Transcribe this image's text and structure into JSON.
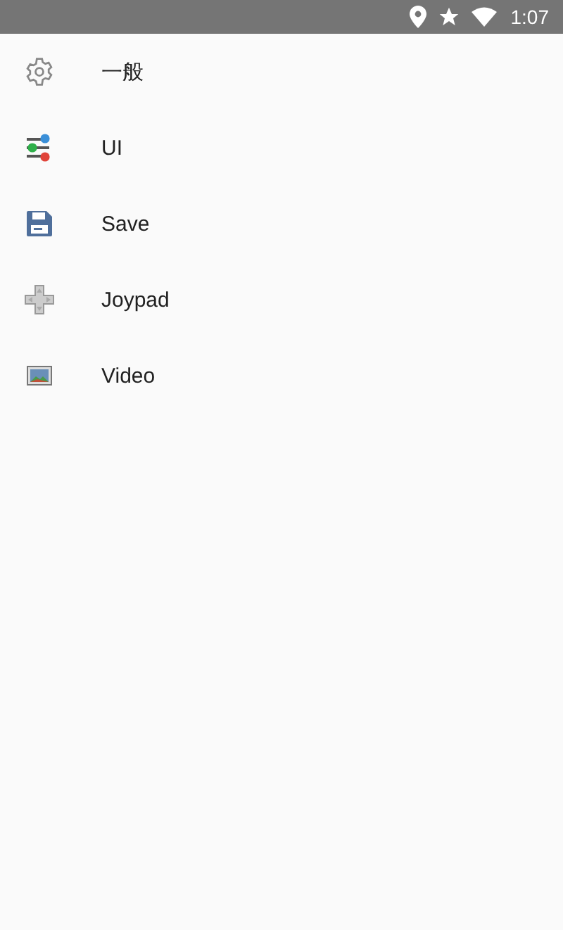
{
  "status_bar": {
    "time": "1:07"
  },
  "menu": [
    {
      "kind": "general",
      "label": "一般"
    },
    {
      "kind": "ui",
      "label": "UI"
    },
    {
      "kind": "save",
      "label": "Save"
    },
    {
      "kind": "joypad",
      "label": "Joypad"
    },
    {
      "kind": "video",
      "label": "Video"
    }
  ]
}
